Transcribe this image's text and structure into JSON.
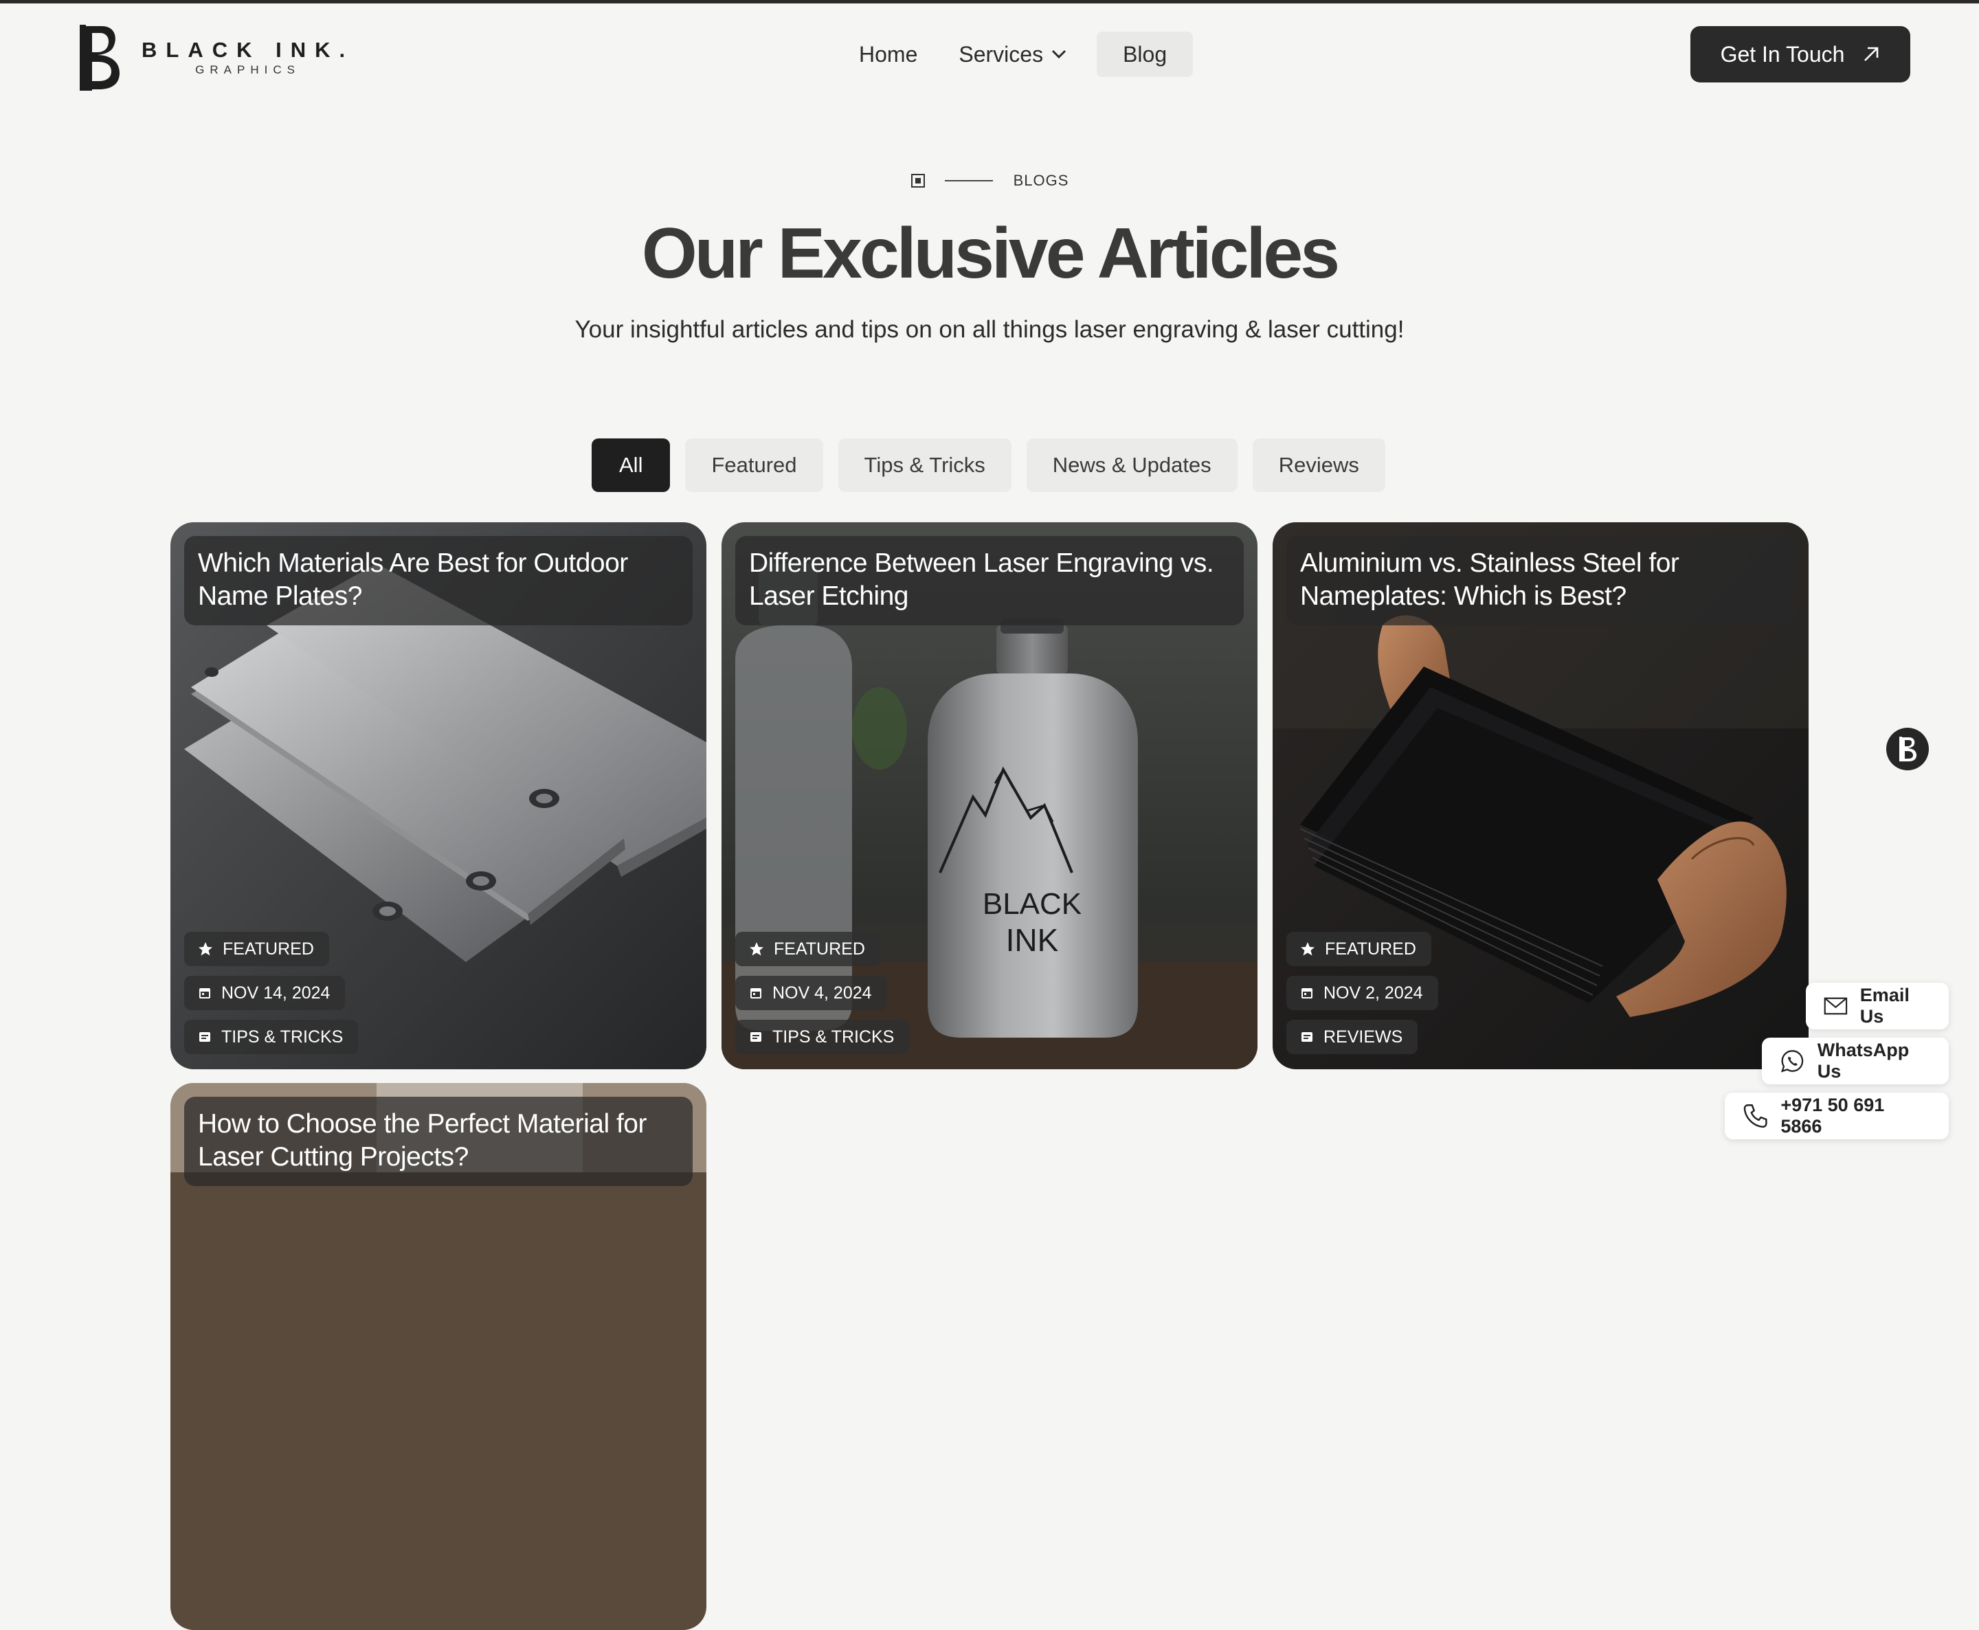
{
  "brand": {
    "name": "BLACK INK.",
    "tagline": "GRAPHICS"
  },
  "nav": {
    "items": [
      {
        "label": "Home"
      },
      {
        "label": "Services"
      },
      {
        "label": "Blog"
      }
    ]
  },
  "cta": {
    "label": "Get In Touch"
  },
  "hero": {
    "eyebrow": "BLOGS",
    "title": "Our Exclusive Articles",
    "subtitle": "Your insightful articles and tips on on all things laser engraving & laser cutting!"
  },
  "filters": [
    "All",
    "Featured",
    "Tips & Tricks",
    "News & Updates",
    "Reviews"
  ],
  "cards": [
    {
      "title": "Which Materials Are Best for Outdoor Name Plates?",
      "badge": "FEATURED",
      "date": "NOV 14, 2024",
      "category": "TIPS & TRICKS"
    },
    {
      "title": "Difference Between Laser Engraving vs. Laser Etching",
      "badge": "FEATURED",
      "date": "NOV 4, 2024",
      "category": "TIPS & TRICKS",
      "image_text": [
        "BLACK",
        "INK"
      ]
    },
    {
      "title": "Aluminium vs. Stainless Steel for Nameplates: Which is Best?",
      "badge": "FEATURED",
      "date": "NOV 2, 2024",
      "category": "REVIEWS"
    },
    {
      "title": "How to Choose the Perfect Material for Laser Cutting Projects?"
    }
  ],
  "contact": {
    "email": "Email Us",
    "whatsapp": "WhatsApp Us",
    "phone": "+971 50 691 5866"
  },
  "colors": {
    "dark": "#2a2a2a",
    "background": "#f5f5f4",
    "chip": "#303030",
    "pill": "#ebebea"
  }
}
